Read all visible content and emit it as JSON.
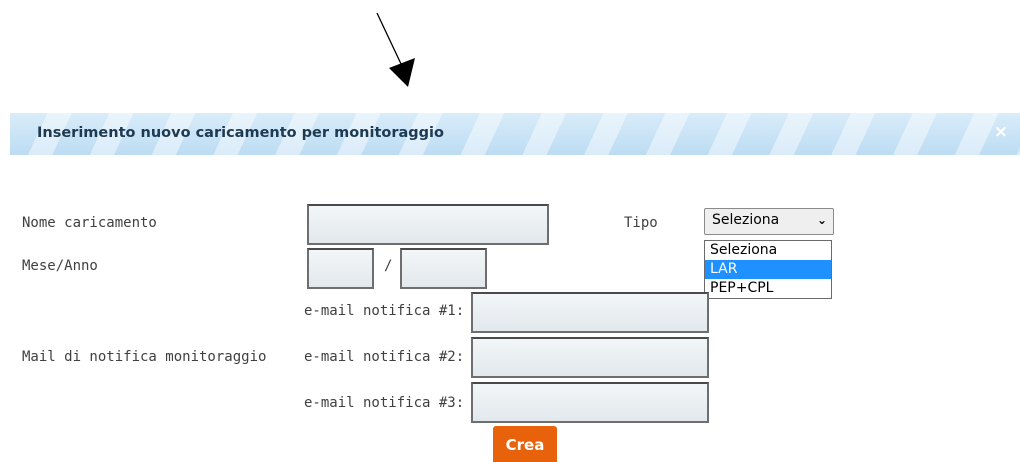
{
  "dialog": {
    "title": "Inserimento nuovo caricamento per monitoraggio",
    "close_icon": "close-icon",
    "close_label": "×"
  },
  "form": {
    "nome_label": "Nome caricamento",
    "tipo_label": "Tipo",
    "mese_anno_label": "Mese/Anno",
    "separator": "/",
    "mail_label": "Mail di notifica monitoraggio",
    "email1_label": "e-mail notifica #1:",
    "email2_label": "e-mail notifica #2:",
    "email3_label": "e-mail notifica #3:",
    "nome_value": "",
    "mese_value": "",
    "anno_value": "",
    "email1_value": "",
    "email2_value": "",
    "email3_value": ""
  },
  "tipo_select": {
    "selected": "Seleziona",
    "chevron_icon": "chevron-down-icon",
    "options": [
      "Seleziona",
      "LAR",
      "PEP+CPL"
    ],
    "highlighted": "LAR"
  },
  "actions": {
    "crea_label": "Crea"
  },
  "colors": {
    "header_bg": "#c8e3f6",
    "button_orange": "#e8620c",
    "highlight_blue": "#1e90ff"
  }
}
